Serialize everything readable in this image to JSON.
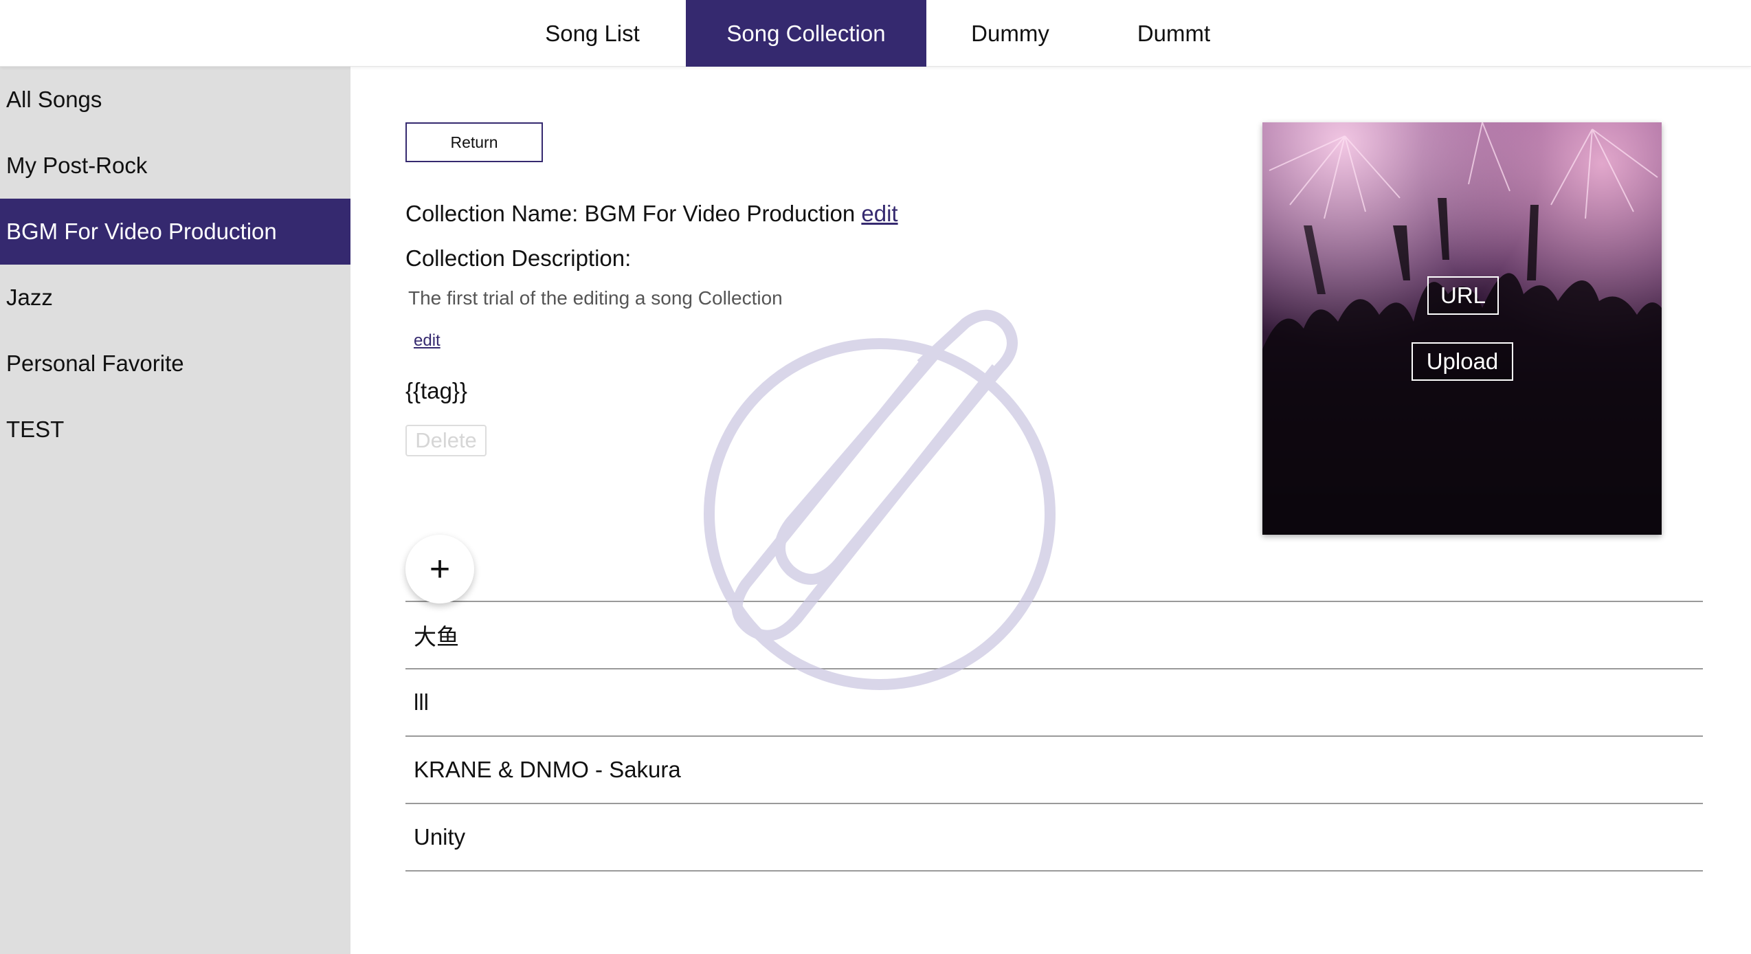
{
  "topnav": {
    "tabs": [
      {
        "label": "Song List",
        "active": false
      },
      {
        "label": "Song Collection",
        "active": true
      },
      {
        "label": "Dummy",
        "active": false
      },
      {
        "label": "Dummt",
        "active": false
      }
    ]
  },
  "sidebar": {
    "items": [
      {
        "label": "All Songs",
        "active": false
      },
      {
        "label": "My Post-Rock",
        "active": false
      },
      {
        "label": "BGM For Video Production",
        "active": true
      },
      {
        "label": "Jazz",
        "active": false
      },
      {
        "label": "Personal Favorite",
        "active": false
      },
      {
        "label": "TEST",
        "active": false
      }
    ]
  },
  "main": {
    "return_label": "Return",
    "collection_name_label": "Collection Name: ",
    "collection_name": "BGM For Video Production",
    "name_edit_label": "edit",
    "description_label": "Collection Description:",
    "description": "The first trial of the editing a song Collection",
    "description_edit_label": "edit",
    "tag_text": "{{tag}}",
    "delete_label": "Delete",
    "add_icon": "plus-icon",
    "add_label": "+",
    "songs": [
      "大鱼",
      "lll",
      "KRANE & DNMO - Sakura",
      "Unity"
    ]
  },
  "cover": {
    "url_label": "URL",
    "upload_label": "Upload"
  },
  "colors": {
    "accent": "#35296f",
    "sidebar_bg": "#dedede",
    "divider": "#9a9a9a"
  }
}
